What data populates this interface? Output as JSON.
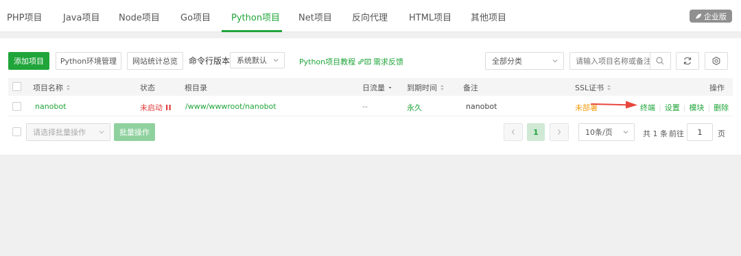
{
  "tabs": [
    {
      "label": "PHP项目",
      "active": false
    },
    {
      "label": "Java项目",
      "active": false
    },
    {
      "label": "Node项目",
      "active": false
    },
    {
      "label": "Go项目",
      "active": false
    },
    {
      "label": "Python项目",
      "active": true
    },
    {
      "label": "Net项目",
      "active": false
    },
    {
      "label": "反向代理",
      "active": false
    },
    {
      "label": "HTML项目",
      "active": false
    },
    {
      "label": "其他项目",
      "active": false
    }
  ],
  "edition_badge": {
    "label": "企业版",
    "icon": "leaf-icon"
  },
  "toolbar": {
    "add_project": "添加项目",
    "python_env": "Python环境管理",
    "site_stats": "网站统计总览",
    "cmd_version_label": "命令行版本",
    "cmd_version_value": "系统默认",
    "tutorial_link": "Python项目教程",
    "feedback_link": "需求反馈",
    "category_value": "全部分类",
    "search_placeholder": "请输入项目名称或备注"
  },
  "table": {
    "headers": {
      "name": "项目名称",
      "status": "状态",
      "root": "根目录",
      "traffic": "日流量",
      "expire": "到期时间",
      "note": "备注",
      "ssl": "SSL证书",
      "actions": "操作"
    },
    "rows": [
      {
        "name": "nanobot",
        "status": "未启动",
        "root": "/www/wwwroot/nanobot",
        "traffic": "--",
        "expire": "永久",
        "note": "nanobot",
        "ssl": "未部署",
        "actions": [
          "终端",
          "设置",
          "模块",
          "删除"
        ]
      }
    ]
  },
  "footer": {
    "batch_select_placeholder": "请选择批量操作",
    "batch_button": "批量操作",
    "current_page": "1",
    "page_size": "10条/页",
    "total_prefix": "共",
    "total_count": "1",
    "total_suffix": "条",
    "goto_label": "前往",
    "goto_value": "1",
    "page_unit": "页"
  },
  "colors": {
    "accent": "#20a53a",
    "danger": "#e23b3b",
    "warning": "#f39c12",
    "arrow": "#e8453c"
  }
}
